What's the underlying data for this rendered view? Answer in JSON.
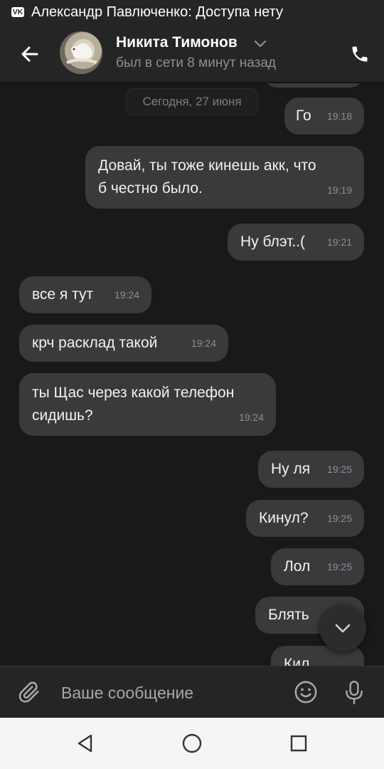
{
  "status_bar": {
    "app_icon": "vk-logo",
    "vk_text": "VK",
    "notification": "Александр Павлюченко: Доступа нету"
  },
  "header": {
    "contact_name": "Никита Тимонов",
    "contact_status": "был в сети 8 минут назад",
    "icons": {
      "back": "arrow-left-icon",
      "dropdown": "chevron-down-icon",
      "call": "phone-icon"
    }
  },
  "chat": {
    "date_separator": "Сегодня, 27 июня",
    "messages": [
      {
        "direction": "out",
        "text": "Го",
        "time": "19:18"
      },
      {
        "direction": "out",
        "text": "Довай, ты тоже кинешь акк, что\nб честно было.",
        "time": "19:19"
      },
      {
        "direction": "out",
        "text": "Ну блэт..(",
        "time": "19:21"
      },
      {
        "direction": "in",
        "text": "все я тут",
        "time": "19:24"
      },
      {
        "direction": "in",
        "text": "крч расклад такой",
        "time": "19:24"
      },
      {
        "direction": "in",
        "text": "ты Щас через какой телефон\nсидишь?",
        "time": "19:24"
      },
      {
        "direction": "out",
        "text": "Ну ля",
        "time": "19:25"
      },
      {
        "direction": "out",
        "text": "Кинул?",
        "time": "19:25"
      },
      {
        "direction": "out",
        "text": "Лол",
        "time": "19:25"
      },
      {
        "direction": "out",
        "text": "Блять",
        "time": ""
      },
      {
        "direction": "out",
        "text": "Кил",
        "time": ""
      }
    ]
  },
  "composer": {
    "placeholder": "Ваше сообщение",
    "value": "",
    "icons": {
      "attach": "paperclip-icon",
      "emoji": "smiley-icon",
      "mic": "microphone-icon"
    }
  },
  "navigation": {
    "icons": [
      "back-triangle-icon",
      "home-circle-icon",
      "recents-square-icon"
    ]
  },
  "colors": {
    "background": "#191919",
    "header": "#252525",
    "bubble": "#3a3a3c",
    "text": "#f2f2f2",
    "muted": "#8e8e93",
    "nav_bar": "#f5f5f5"
  }
}
